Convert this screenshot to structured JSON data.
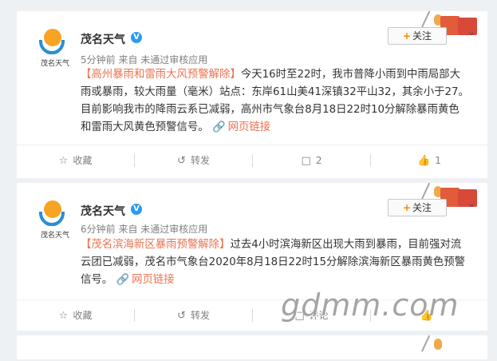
{
  "posts": [
    {
      "account": "茂名天气",
      "logo_text": "茂名天气",
      "verified": "V",
      "time": "5分钟前",
      "source": "来自 未通过审核应用",
      "follow_label": "关注",
      "follow_plus": "+",
      "text_title": "【高州暴雨和雷雨大风预警解除】",
      "text_lines": [
        "今天16时至22时，我市普降小雨到中雨局部大",
        "雨或暴雨，较大雨量（毫米）站点：东岸61山美41深镇32平山32，其余小于27。",
        "目前影响我市的降雨云系已减弱，高州市气象台8月18日22时10分解除暴雨黄色",
        "和雷雨大风黄色预警信号。"
      ],
      "web_link": "网页链接",
      "actions": {
        "favorite": "收藏",
        "repost": "转发",
        "comment_count": "2",
        "like_count": "1"
      }
    },
    {
      "account": "茂名天气",
      "logo_text": "茂名天气",
      "verified": "V",
      "time": "6分钟前",
      "source": "来自 未通过审核应用",
      "follow_label": "关注",
      "follow_plus": "+",
      "text_title": "【茂名滨海新区暴雨预警解除】",
      "text_lines": [
        "过去4小时滨海新区出现大雨到暴雨，目前强对流",
        "云团已减弱，茂名市气象台2020年8月18日22时15分解除滨海新区暴雨黄色预警",
        "信号。"
      ],
      "web_link": "网页链接",
      "actions": {
        "favorite": "收藏",
        "repost": "转发",
        "comment": "评论"
      }
    }
  ],
  "watermark": "gdmm.com",
  "colors": {
    "link": "#eb7350",
    "verified": "#2b9bf4",
    "follow_plus": "#ff8200",
    "logo_sun": "#f7a424",
    "logo_wave": "#2b8ed4"
  },
  "icons": {
    "more": "chevron-down-icon",
    "favorite": "star-icon",
    "repost": "repost-icon",
    "comment": "comment-icon",
    "like": "thumb-up-icon",
    "link": "link-icon"
  }
}
